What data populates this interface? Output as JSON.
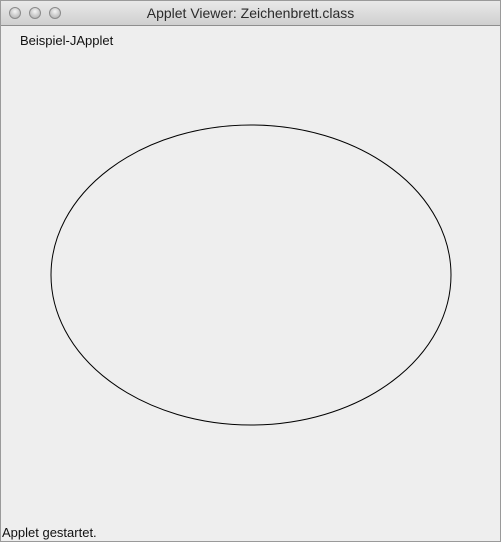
{
  "window": {
    "title": "Applet Viewer: Zeichenbrett.class"
  },
  "applet": {
    "label": "Beispiel-JApplet",
    "drawing": {
      "shape": "ellipse",
      "stroke_color": "#000000"
    }
  },
  "status": {
    "text": "Applet gestartet."
  }
}
